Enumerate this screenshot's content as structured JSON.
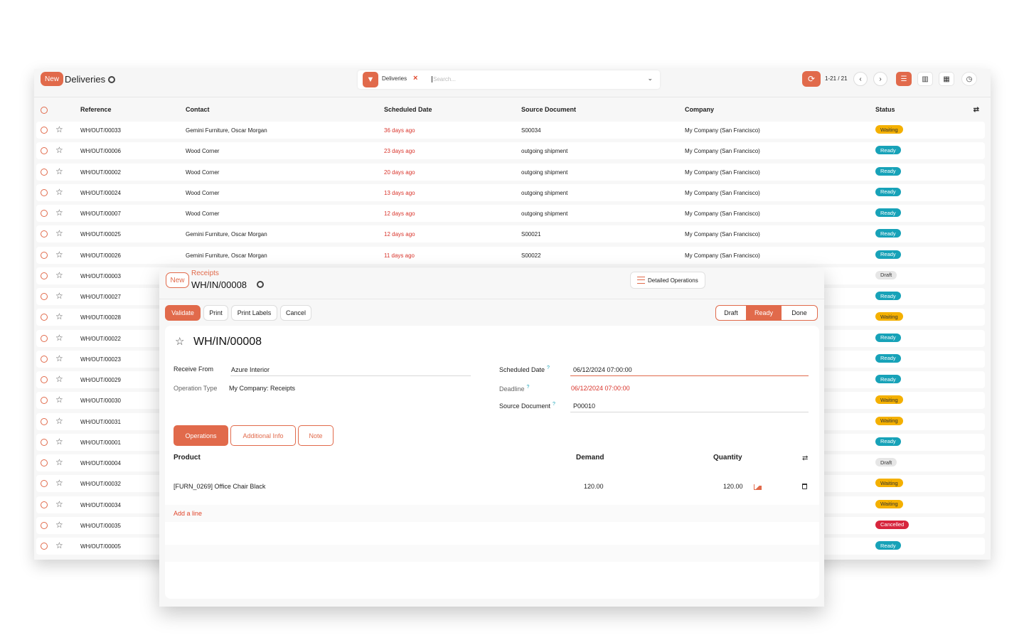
{
  "list_view": {
    "new_label": "New",
    "title": "Deliveries",
    "search": {
      "facet": "Deliveries",
      "facet_remove": "×",
      "placeholder": "Search..."
    },
    "pager": "1-21 / 21",
    "columns": [
      "Reference",
      "Contact",
      "Scheduled Date",
      "Source Document",
      "Company",
      "Status"
    ],
    "rows": [
      {
        "ref": "WH/OUT/00033",
        "contact": "Gemini Furniture, Oscar Morgan",
        "date": "36 days ago",
        "source": "S00034",
        "company": "My Company (San Francisco)",
        "status": "Waiting"
      },
      {
        "ref": "WH/OUT/00006",
        "contact": "Wood Corner",
        "date": "23 days ago",
        "source": "outgoing shipment",
        "company": "My Company (San Francisco)",
        "status": "Ready"
      },
      {
        "ref": "WH/OUT/00002",
        "contact": "Wood Corner",
        "date": "20 days ago",
        "source": "outgoing shipment",
        "company": "My Company (San Francisco)",
        "status": "Ready"
      },
      {
        "ref": "WH/OUT/00024",
        "contact": "Wood Corner",
        "date": "13 days ago",
        "source": "outgoing shipment",
        "company": "My Company (San Francisco)",
        "status": "Ready"
      },
      {
        "ref": "WH/OUT/00007",
        "contact": "Wood Corner",
        "date": "12 days ago",
        "source": "outgoing shipment",
        "company": "My Company (San Francisco)",
        "status": "Ready"
      },
      {
        "ref": "WH/OUT/00025",
        "contact": "Gemini Furniture, Oscar Morgan",
        "date": "12 days ago",
        "source": "S00021",
        "company": "My Company (San Francisco)",
        "status": "Ready"
      },
      {
        "ref": "WH/OUT/00026",
        "contact": "Gemini Furniture, Oscar Morgan",
        "date": "11 days ago",
        "source": "S00022",
        "company": "My Company (San Francisco)",
        "status": "Ready"
      },
      {
        "ref": "WH/OUT/00003",
        "contact": "",
        "date": "",
        "source": "",
        "company": "",
        "status": "Draft"
      },
      {
        "ref": "WH/OUT/00027",
        "contact": "",
        "date": "",
        "source": "",
        "company": "",
        "status": "Ready"
      },
      {
        "ref": "WH/OUT/00028",
        "contact": "",
        "date": "",
        "source": "",
        "company": "",
        "status": "Waiting"
      },
      {
        "ref": "WH/OUT/00022",
        "contact": "",
        "date": "",
        "source": "",
        "company": "",
        "status": "Ready"
      },
      {
        "ref": "WH/OUT/00023",
        "contact": "",
        "date": "",
        "source": "",
        "company": "",
        "status": "Ready"
      },
      {
        "ref": "WH/OUT/00029",
        "contact": "",
        "date": "",
        "source": "",
        "company": "",
        "status": "Ready"
      },
      {
        "ref": "WH/OUT/00030",
        "contact": "",
        "date": "",
        "source": "",
        "company": "",
        "status": "Waiting"
      },
      {
        "ref": "WH/OUT/00031",
        "contact": "",
        "date": "",
        "source": "",
        "company": "",
        "status": "Waiting"
      },
      {
        "ref": "WH/OUT/00001",
        "contact": "",
        "date": "",
        "source": "",
        "company": "",
        "status": "Ready"
      },
      {
        "ref": "WH/OUT/00004",
        "contact": "",
        "date": "",
        "source": "",
        "company": "",
        "status": "Draft"
      },
      {
        "ref": "WH/OUT/00032",
        "contact": "",
        "date": "",
        "source": "",
        "company": "",
        "status": "Waiting"
      },
      {
        "ref": "WH/OUT/00034",
        "contact": "",
        "date": "",
        "source": "",
        "company": "",
        "status": "Waiting"
      },
      {
        "ref": "WH/OUT/00035",
        "contact": "",
        "date": "",
        "source": "",
        "company": "",
        "status": "Cancelled"
      },
      {
        "ref": "WH/OUT/00005",
        "contact": "",
        "date": "",
        "source": "",
        "company": "",
        "status": "Ready"
      }
    ]
  },
  "form_view": {
    "new_label": "New",
    "breadcrumb": "Receipts",
    "record": "WH/IN/00008",
    "detailed_operations": "Detailed Operations",
    "actions": {
      "validate": "Validate",
      "print": "Print",
      "print_labels": "Print Labels",
      "cancel": "Cancel"
    },
    "statusbar": [
      "Draft",
      "Ready",
      "Done"
    ],
    "status_active": "Ready",
    "title": "WH/IN/00008",
    "fields": {
      "receive_from_label": "Receive From",
      "receive_from": "Azure Interior",
      "operation_type_label": "Operation Type",
      "operation_type": "My Company: Receipts",
      "scheduled_date_label": "Scheduled Date",
      "scheduled_date": "06/12/2024 07:00:00",
      "deadline_label": "Deadline",
      "deadline": "06/12/2024 07:00:00",
      "source_document_label": "Source Document",
      "source_document": "P00010",
      "help_mark": "?"
    },
    "tabs": [
      "Operations",
      "Additional Info",
      "Note"
    ],
    "operations": {
      "columns": {
        "product": "Product",
        "demand": "Demand",
        "quantity": "Quantity"
      },
      "lines": [
        {
          "product": "[FURN_0269] Office Chair Black",
          "demand": "120.00",
          "quantity": "120.00"
        }
      ],
      "add_line": "Add a line"
    }
  },
  "colors": {
    "accent": "#e16a4b",
    "late": "#d9342b",
    "ready": "#17a2b8",
    "waiting": "#f4b000",
    "cancelled": "#d7263d"
  }
}
